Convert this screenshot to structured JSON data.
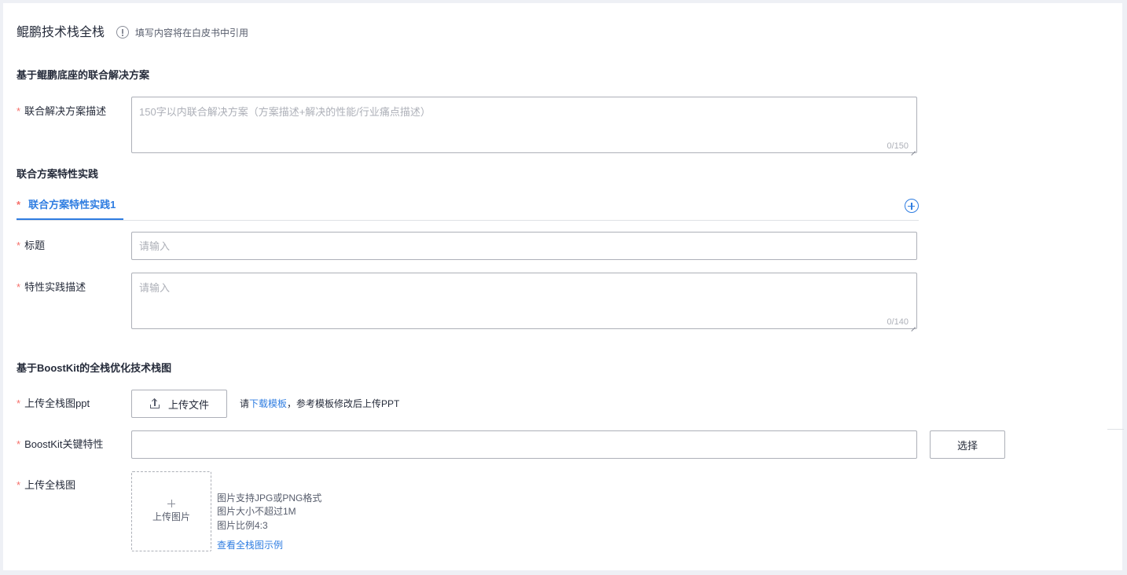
{
  "header": {
    "title": "鲲鹏技术栈全栈",
    "hint": "填写内容将在白皮书中引用"
  },
  "section1": {
    "title": "基于鲲鹏底座的联合解决方案",
    "field_label": "联合解决方案描述",
    "required_mark": "*",
    "placeholder": "150字以内联合解决方案（方案描述+解决的性能/行业痛点描述）",
    "counter": "0/150"
  },
  "section2": {
    "title": "联合方案特性实践",
    "tab_label": "联合方案特性实践1",
    "title_label": "标题",
    "title_placeholder": "请输入",
    "desc_label": "特性实践描述",
    "desc_placeholder": "请输入",
    "desc_counter": "0/140"
  },
  "section3": {
    "title": "基于BoostKit的全栈优化技术栈图",
    "ppt_label": "上传全栈图ppt",
    "upload_button": "上传文件",
    "tip_prefix": "请",
    "tip_link": "下载模板",
    "tip_suffix": "，参考模板修改后上传PPT",
    "feature_label": "BoostKit关键特性",
    "feature_value": "",
    "select_button": "选择",
    "image_label": "上传全栈图",
    "upload_image": "上传图片",
    "image_tips": [
      "图片支持JPG或PNG格式",
      "图片大小不超过1M",
      "图片比例4:3"
    ],
    "example_link": "查看全栈图示例"
  },
  "colors": {
    "primary": "#2f7de1",
    "required": "#f66f6a",
    "border": "#adb0b8",
    "placeholder": "#adb0b8"
  }
}
